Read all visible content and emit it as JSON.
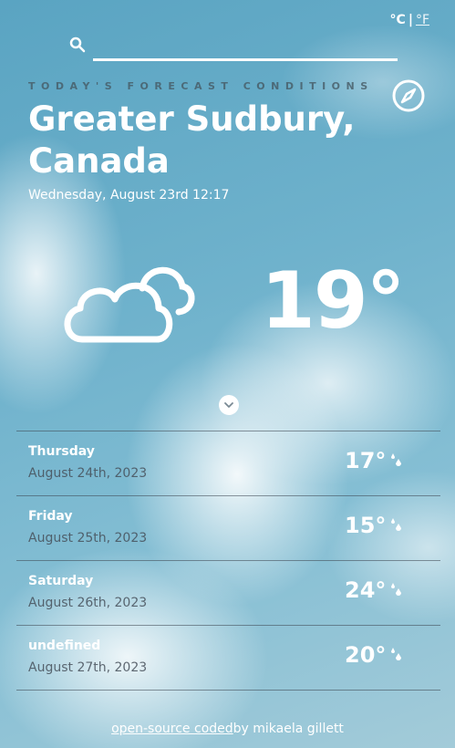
{
  "units": {
    "celsius": "°C",
    "separator": "|",
    "fahrenheit": "°F"
  },
  "search": {
    "value": "",
    "icon": "search-icon"
  },
  "header": {
    "eyebrow": "TODAY'S FORECAST CONDITIONS",
    "compass_icon": "compass-icon",
    "city": "Greater Sudbury, Canada",
    "datetime": "Wednesday, August 23rd 12:17"
  },
  "current": {
    "icon": "cloudy-icon",
    "temperature": "19°"
  },
  "expand_icon": "chevron-down-icon",
  "forecast": [
    {
      "day": "Thursday",
      "date": "August 24th, 2023",
      "temp": "17°",
      "icon": "rain-drops-icon"
    },
    {
      "day": "Friday",
      "date": "August 25th, 2023",
      "temp": "15°",
      "icon": "rain-drops-icon"
    },
    {
      "day": "Saturday",
      "date": "August 26th, 2023",
      "temp": "24°",
      "icon": "rain-drops-icon"
    },
    {
      "day": "undefined",
      "date": "August 27th, 2023",
      "temp": "20°",
      "icon": "rain-drops-icon"
    }
  ],
  "footer": {
    "link_text": "open-source coded",
    "credit": "by mikaela gillett"
  },
  "colors": {
    "text": "#ffffff",
    "sky": "#6fb2cc",
    "muted": "#46505a"
  }
}
